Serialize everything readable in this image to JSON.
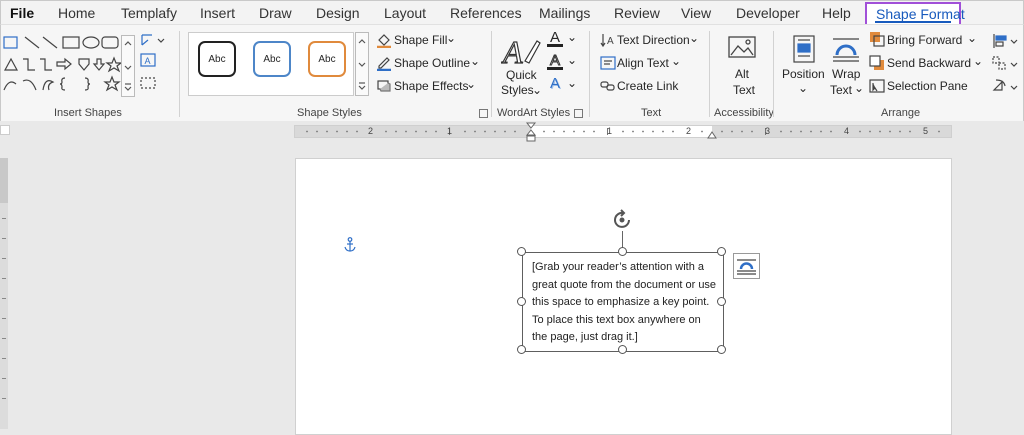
{
  "tabs": {
    "file": "File",
    "home": "Home",
    "templafy": "Templafy",
    "insert": "Insert",
    "draw": "Draw",
    "design": "Design",
    "layout": "Layout",
    "references": "References",
    "mailings": "Mailings",
    "review": "Review",
    "view": "View",
    "developer": "Developer",
    "help": "Help",
    "shape_format": "Shape Format"
  },
  "ribbon": {
    "insert_shapes": {
      "label": "Insert Shapes"
    },
    "shape_styles": {
      "label": "Shape Styles",
      "presets": [
        "Abc",
        "Abc",
        "Abc"
      ],
      "fill": "Shape Fill",
      "outline": "Shape Outline",
      "effects": "Shape Effects"
    },
    "wordart": {
      "label": "WordArt Styles",
      "quick_styles_line1": "Quick",
      "quick_styles_line2": "Styles"
    },
    "text": {
      "label": "Text",
      "direction": "Text Direction",
      "align": "Align Text",
      "link": "Create Link"
    },
    "accessibility": {
      "label": "Accessibility",
      "alt_line1": "Alt",
      "alt_line2": "Text"
    },
    "arrange": {
      "label": "Arrange",
      "position": "Position",
      "wrap_line1": "Wrap",
      "wrap_line2": "Text",
      "bring_forward": "Bring Forward",
      "send_backward": "Send Backward",
      "selection_pane": "Selection Pane"
    }
  },
  "ruler": {
    "ticks": [
      "2",
      "1",
      "1",
      "2",
      "3",
      "4",
      "5"
    ]
  },
  "document": {
    "textbox_text": "[Grab your reader’s attention with a great quote from the document or use this space to emphasize a key point. To place this text box anywhere on the page, just drag it.]"
  },
  "colors": {
    "accent": "#185abd",
    "highlight": "#a150d8"
  }
}
